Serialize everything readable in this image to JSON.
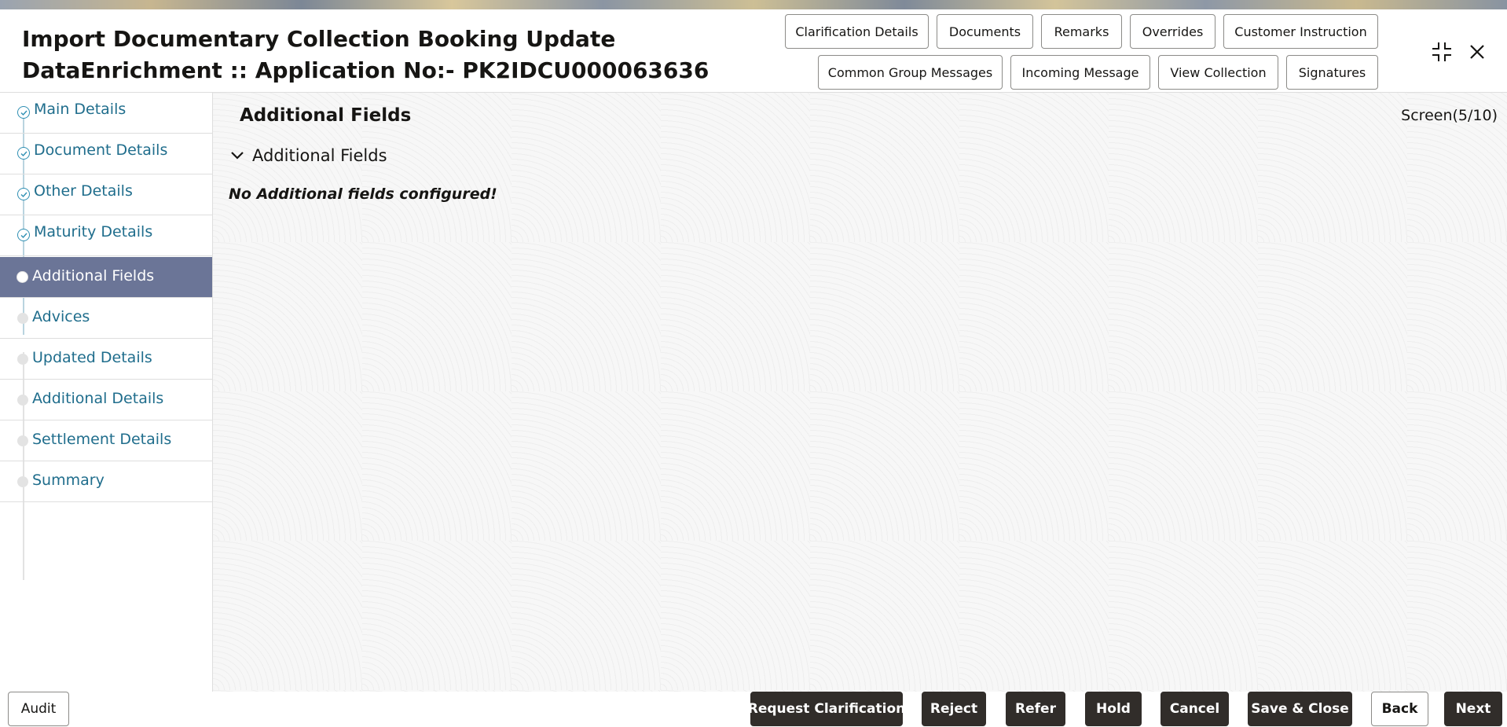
{
  "header": {
    "title_line1": "Import Documentary Collection Booking Update",
    "title_line2": "DataEnrichment :: Application No:- PK2IDCU000063636",
    "buttons_row1": [
      "Clarification Details",
      "Documents",
      "Remarks",
      "Overrides",
      "Customer Instruction"
    ],
    "buttons_row2": [
      "Common Group Messages",
      "Incoming Message",
      "View Collection",
      "Signatures"
    ],
    "icons": {
      "collapse": "collapse-icon",
      "close": "close-icon"
    }
  },
  "sidebar": {
    "items": [
      {
        "label": "Main Details",
        "state": "done"
      },
      {
        "label": "Document Details",
        "state": "done"
      },
      {
        "label": "Other Details",
        "state": "done"
      },
      {
        "label": "Maturity Details",
        "state": "done"
      },
      {
        "label": "Additional Fields",
        "state": "current"
      },
      {
        "label": "Advices",
        "state": "pending"
      },
      {
        "label": "Updated Details",
        "state": "pending"
      },
      {
        "label": "Additional Details",
        "state": "pending"
      },
      {
        "label": "Settlement Details",
        "state": "pending"
      },
      {
        "label": "Summary",
        "state": "pending"
      }
    ]
  },
  "main": {
    "section_title": "Additional Fields",
    "screen_counter": "Screen(5/10)",
    "panel_title": "Additional Fields",
    "empty_message": "No Additional fields configured!"
  },
  "footer": {
    "audit": "Audit",
    "request_clarification": "Request Clarification",
    "reject": "Reject",
    "refer": "Refer",
    "hold": "Hold",
    "cancel": "Cancel",
    "save_close": "Save & Close",
    "back": "Back",
    "next": "Next"
  },
  "colors": {
    "accent": "#1f6d8c",
    "active_step_bg": "#6b7597",
    "dark_button": "#312d2a"
  }
}
